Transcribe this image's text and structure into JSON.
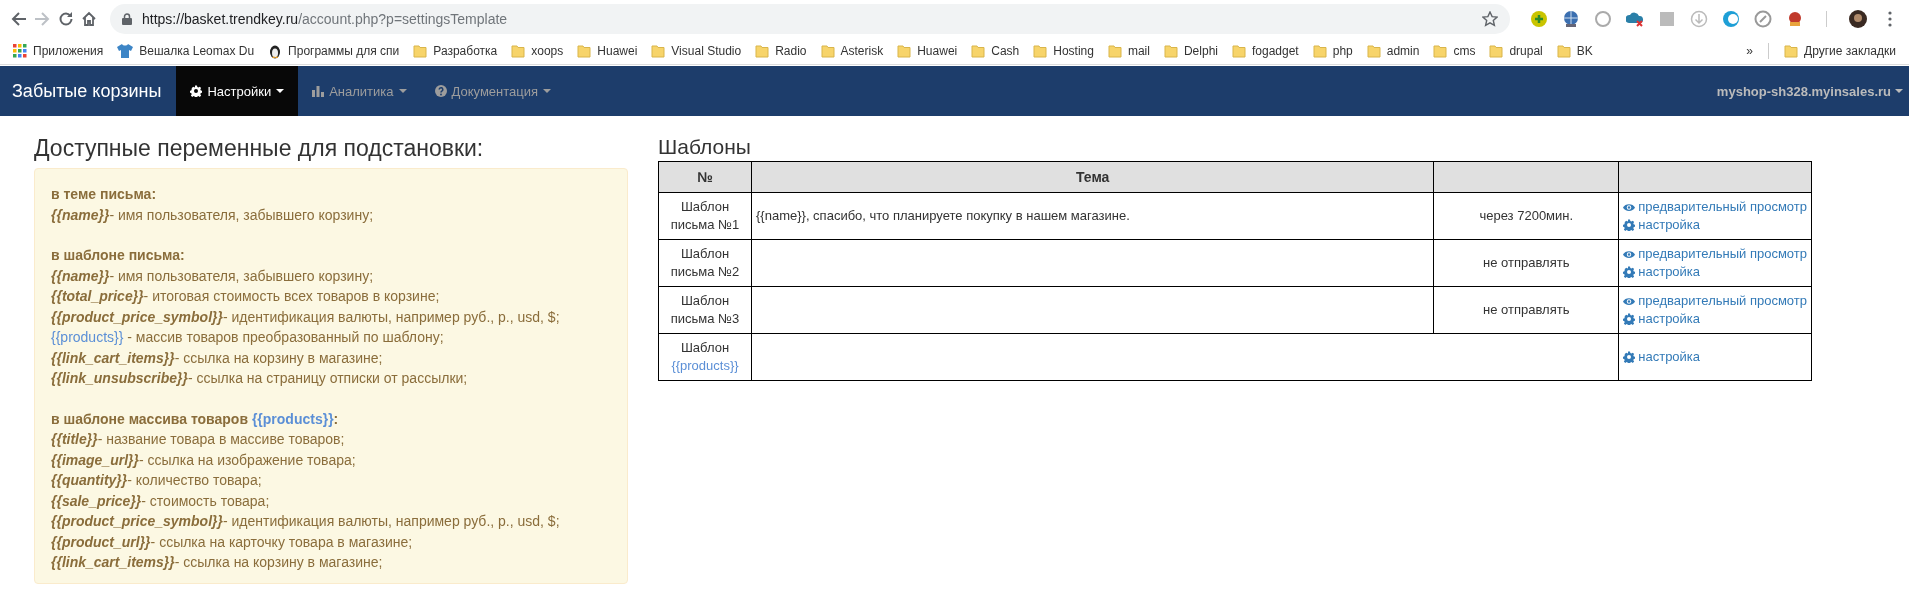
{
  "browser": {
    "url_host": "https://basket.trendkey.ru",
    "url_path": "/account.php?p=settingsTemplate",
    "bookmarks": [
      {
        "kind": "apps",
        "label": "Приложения"
      },
      {
        "kind": "shirt",
        "label": "Вешалка Leomax Du"
      },
      {
        "kind": "penguin",
        "label": "Программы для спи"
      },
      {
        "kind": "folder",
        "label": "Разработка"
      },
      {
        "kind": "folder",
        "label": "xoops"
      },
      {
        "kind": "folder",
        "label": "Huawei"
      },
      {
        "kind": "folder",
        "label": "Visual Studio"
      },
      {
        "kind": "folder",
        "label": "Radio"
      },
      {
        "kind": "folder",
        "label": "Asterisk"
      },
      {
        "kind": "folder",
        "label": "Huawei"
      },
      {
        "kind": "folder",
        "label": "Cash"
      },
      {
        "kind": "folder",
        "label": "Hosting"
      },
      {
        "kind": "folder",
        "label": "mail"
      },
      {
        "kind": "folder",
        "label": "Delphi"
      },
      {
        "kind": "folder",
        "label": "fogadget"
      },
      {
        "kind": "folder",
        "label": "php"
      },
      {
        "kind": "folder",
        "label": "admin"
      },
      {
        "kind": "folder",
        "label": "cms"
      },
      {
        "kind": "folder",
        "label": "drupal"
      },
      {
        "kind": "folder",
        "label": "BK"
      }
    ],
    "more": "»",
    "other_bookmarks": "Другие закладки"
  },
  "navbar": {
    "brand": "Забытые корзины",
    "items": [
      {
        "kind": "gear",
        "label": "Настройки",
        "selected": true
      },
      {
        "kind": "chart",
        "label": "Аналитика",
        "selected": false
      },
      {
        "kind": "question",
        "label": "Документация",
        "selected": false
      }
    ],
    "account": "myshop-sh328.myinsales.ru"
  },
  "variables": {
    "title": "Доступные переменные для подстановки:",
    "sections": [
      {
        "title": "в теме письма:",
        "lines": [
          {
            "kind": "var",
            "variable": "{{name}}",
            "description": "- имя пользователя, забывшего корзину;"
          }
        ]
      },
      {
        "title": "в шаблоне письма:",
        "lines": [
          {
            "kind": "var",
            "variable": "{{name}}",
            "description": "- имя пользователя, забывшего корзину;"
          },
          {
            "kind": "var",
            "variable": "{{total_price}}",
            "description": "- итоговая стоимость всех товаров в корзине;"
          },
          {
            "kind": "var",
            "variable": "{{product_price_symbol}}",
            "description": "- идентификация валюты, например руб., р., usd, $;"
          },
          {
            "kind": "link",
            "variable": "{{products}}",
            "description": "- массив товаров преобразованный по шаблону;"
          },
          {
            "kind": "var",
            "variable": "{{link_cart_items}}",
            "description": "- ссылка на корзину в магазине;"
          },
          {
            "kind": "var",
            "variable": "{{link_unsubscribe}}",
            "description": "- ссылка на страницу отписки от рассылки;"
          }
        ]
      },
      {
        "title": "в шаблоне массива товаров",
        "title_link": "{{products}}",
        "title_suffix": ":",
        "lines": [
          {
            "kind": "var",
            "variable": "{{title}}",
            "description": "- название товара в массиве товаров;"
          },
          {
            "kind": "var",
            "variable": "{{image_url}}",
            "description": "- ссылка на изображение товара;"
          },
          {
            "kind": "var",
            "variable": "{{quantity}}",
            "description": "- количество товара;"
          },
          {
            "kind": "var",
            "variable": "{{sale_price}}",
            "description": "- стоимость товара;"
          },
          {
            "kind": "var",
            "variable": "{{product_price_symbol}}",
            "description": "- идентификация валюты, например руб., р., usd, $;"
          },
          {
            "kind": "var",
            "variable": "{{product_url}}",
            "description": "- ссылка на карточку товара в магазине;"
          },
          {
            "kind": "var",
            "variable": "{{link_cart_items}}",
            "description": "- ссылка на корзину в магазине;"
          }
        ]
      }
    ]
  },
  "templates": {
    "title": "Шаблоны",
    "columns": [
      "№",
      "Тема"
    ],
    "rows": [
      {
        "name": "Шаблон письма №1",
        "subject": "{{name}}, спасибо, что планируете покупку в нашем магазине.",
        "delay": "через 7200мин.",
        "actions": [
          {
            "kind": "preview",
            "label": "предварительный просмотр"
          },
          {
            "kind": "settings",
            "label": "настройка"
          }
        ]
      },
      {
        "name": "Шаблон письма №2",
        "delay": "не отправлять",
        "actions": [
          {
            "kind": "preview",
            "label": "предварительный просмотр"
          },
          {
            "kind": "settings",
            "label": "настройка"
          }
        ]
      },
      {
        "name": "Шаблон письма №3",
        "delay": "не отправлять",
        "actions": [
          {
            "kind": "preview",
            "label": "предварительный просмотр"
          },
          {
            "kind": "settings",
            "label": "настройка"
          }
        ]
      },
      {
        "name": "Шаблон",
        "name_link": "{{products}}",
        "actions": [
          {
            "kind": "settings",
            "label": "настройка"
          }
        ]
      }
    ]
  }
}
